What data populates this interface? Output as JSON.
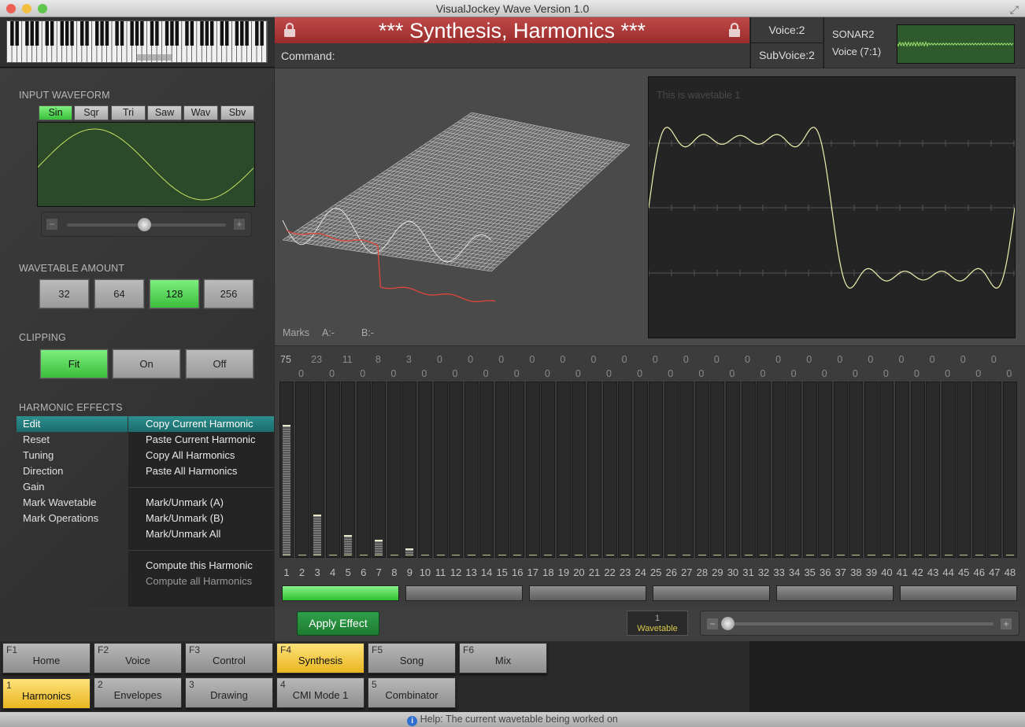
{
  "window": {
    "title": "VisualJockey Wave Version 1.0"
  },
  "header": {
    "synth_title": "*** Synthesis, Harmonics ***",
    "command_label": "Command:",
    "voice": "Voice:2",
    "subvoice": "SubVoice:2",
    "sonar_name": "SONAR2",
    "sonar_voice": "Voice (7:1)"
  },
  "input_waveform": {
    "label": "INPUT WAVEFORM",
    "buttons": [
      "Sin",
      "Sqr",
      "Tri",
      "Saw",
      "Wav",
      "Sbv"
    ],
    "selected": "Sin"
  },
  "wavetable_amount": {
    "label": "WAVETABLE AMOUNT",
    "options": [
      "32",
      "64",
      "128",
      "256"
    ],
    "selected": "128"
  },
  "clipping": {
    "label": "CLIPPING",
    "options": [
      "Fit",
      "On",
      "Off"
    ],
    "selected": "Fit"
  },
  "harmonic_effects": {
    "label": "HARMONIC EFFECTS",
    "menu": [
      "Edit",
      "Reset",
      "Tuning",
      "Direction",
      "Gain",
      "Mark Wavetable",
      "Mark Operations"
    ],
    "selected": "Edit",
    "submenu": {
      "copy_current": "Copy Current Harmonic",
      "paste_current": "Paste Current Harmonic",
      "copy_all": "Copy All Harmonics",
      "paste_all": "Paste All Harmonics",
      "mark_a": "Mark/Unmark (A)",
      "mark_b": "Mark/Unmark (B)",
      "mark_all": "Mark/Unmark All",
      "compute_this": "Compute this Harmonic",
      "compute_all": "Compute all Harmonics"
    }
  },
  "view3d": {
    "marks": "Marks",
    "mark_a": "A:-",
    "mark_b": "B:-"
  },
  "scope": {
    "caption": "This is wavetable 1"
  },
  "harmonics": {
    "top_values_row1": [
      "75",
      "23",
      "11",
      "8",
      "3",
      "0",
      "0",
      "0",
      "0",
      "0",
      "0",
      "0",
      "0",
      "0",
      "0",
      "0",
      "0",
      "0",
      "0",
      "0",
      "0",
      "0",
      "0",
      "0"
    ],
    "top_values_row2": [
      "0",
      "0",
      "0",
      "0",
      "0",
      "0",
      "0",
      "0",
      "0",
      "0",
      "0",
      "0",
      "0",
      "0",
      "0",
      "0",
      "0",
      "0",
      "0",
      "0",
      "0",
      "0",
      "0",
      "0"
    ],
    "levels": [
      0.76,
      0,
      0.24,
      0,
      0.12,
      0,
      0.09,
      0,
      0.04,
      0,
      0,
      0,
      0,
      0,
      0,
      0,
      0,
      0,
      0,
      0,
      0,
      0,
      0,
      0,
      0,
      0,
      0,
      0,
      0,
      0,
      0,
      0,
      0,
      0,
      0,
      0,
      0,
      0,
      0,
      0,
      0,
      0,
      0,
      0,
      0,
      0,
      0,
      0
    ],
    "numbers": [
      "1",
      "2",
      "3",
      "4",
      "5",
      "6",
      "7",
      "8",
      "9",
      "10",
      "11",
      "12",
      "13",
      "14",
      "15",
      "16",
      "17",
      "18",
      "19",
      "20",
      "21",
      "22",
      "23",
      "24",
      "25",
      "26",
      "27",
      "28",
      "29",
      "30",
      "31",
      "32",
      "33",
      "34",
      "35",
      "36",
      "37",
      "38",
      "39",
      "40",
      "41",
      "42",
      "43",
      "44",
      "45",
      "46",
      "47",
      "48"
    ],
    "page_selected": 0
  },
  "apply": {
    "label": "Apply Effect",
    "wt_number": "1",
    "wt_label": "Wavetable"
  },
  "tabs_row1": [
    {
      "key": "F1",
      "label": "Home"
    },
    {
      "key": "F2",
      "label": "Voice"
    },
    {
      "key": "F3",
      "label": "Control"
    },
    {
      "key": "F4",
      "label": "Synthesis"
    },
    {
      "key": "F5",
      "label": "Song"
    },
    {
      "key": "F6",
      "label": "Mix"
    }
  ],
  "tabs_row2": [
    {
      "key": "1",
      "label": "Harmonics"
    },
    {
      "key": "2",
      "label": "Envelopes"
    },
    {
      "key": "3",
      "label": "Drawing"
    },
    {
      "key": "4",
      "label": "CMI Mode 1"
    },
    {
      "key": "5",
      "label": "Combinator"
    }
  ],
  "tab_selected_row1": "Synthesis",
  "tab_selected_row2": "Harmonics",
  "help": {
    "text": "Help: The current wavetable being worked on"
  },
  "colors": {
    "accent_green": "#5ee05e",
    "title_red": "#b23b3b",
    "tab_yellow": "#f2c94c",
    "teal_select": "#237d7d"
  }
}
